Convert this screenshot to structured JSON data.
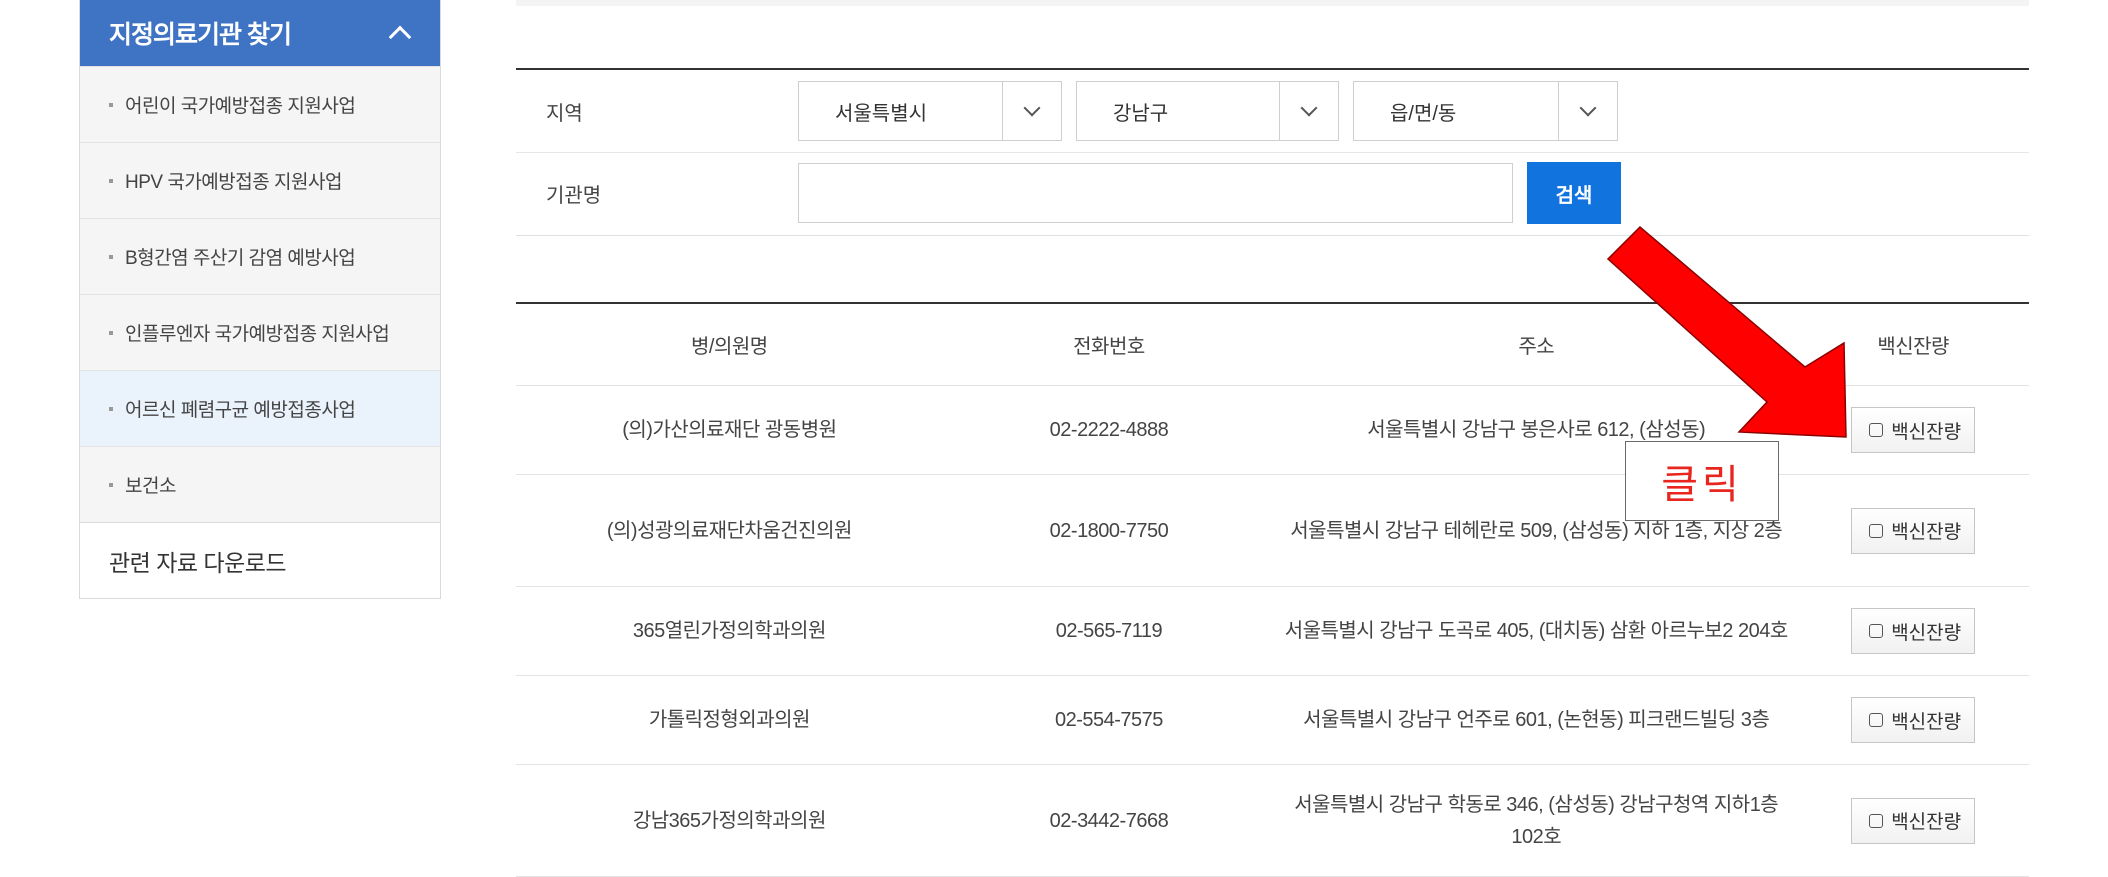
{
  "sidebar": {
    "title": "지정의료기관 찾기",
    "items": [
      {
        "label": "어린이 국가예방접종 지원사업"
      },
      {
        "label": "HPV 국가예방접종 지원사업"
      },
      {
        "label": "B형간염 주산기 감염 예방사업"
      },
      {
        "label": "인플루엔자 국가예방접종 지원사업"
      },
      {
        "label": "어르신 폐렴구균 예방접종사업"
      },
      {
        "label": "보건소"
      }
    ],
    "download_label": "관련 자료 다운로드"
  },
  "search": {
    "region_label": "지역",
    "city": "서울특별시",
    "district": "강남구",
    "town": "읍/면/동",
    "name_label": "기관명",
    "name_value": "",
    "button_label": "검색"
  },
  "table": {
    "headers": [
      "병/의원명",
      "전화번호",
      "주소",
      "백신잔량"
    ],
    "rows": [
      {
        "name": "(의)가산의료재단 광동병원",
        "phone": "02-2222-4888",
        "address": "서울특별시 강남구 봉은사로 612, (삼성동)",
        "button": "백신잔량"
      },
      {
        "name": "(의)성광의료재단차움건진의원",
        "phone": "02-1800-7750",
        "address": "서울특별시 강남구 테헤란로 509, (삼성동) 지하 1층, 지상 2층",
        "button": "백신잔량"
      },
      {
        "name": "365열린가정의학과의원",
        "phone": "02-565-7119",
        "address": "서울특별시 강남구 도곡로 405, (대치동) 삼환 아르누보2 204호",
        "button": "백신잔량"
      },
      {
        "name": "가톨릭정형외과의원",
        "phone": "02-554-7575",
        "address": "서울특별시 강남구 언주로 601, (논현동) 피크랜드빌딩 3층",
        "button": "백신잔량"
      },
      {
        "name": "강남365가정의학과의원",
        "phone": "02-3442-7668",
        "address": "서울특별시 강남구 학동로 346, (삼성동) 강남구청역 지하1층 102호",
        "button": "백신잔량"
      }
    ]
  },
  "annotation": {
    "callout_text": "클릭",
    "arrow_color": "#ff0000"
  },
  "colors": {
    "sidebar_header": "#3f73c4",
    "search_button": "#1173dd",
    "active_item_bg": "#eaf3fc"
  }
}
